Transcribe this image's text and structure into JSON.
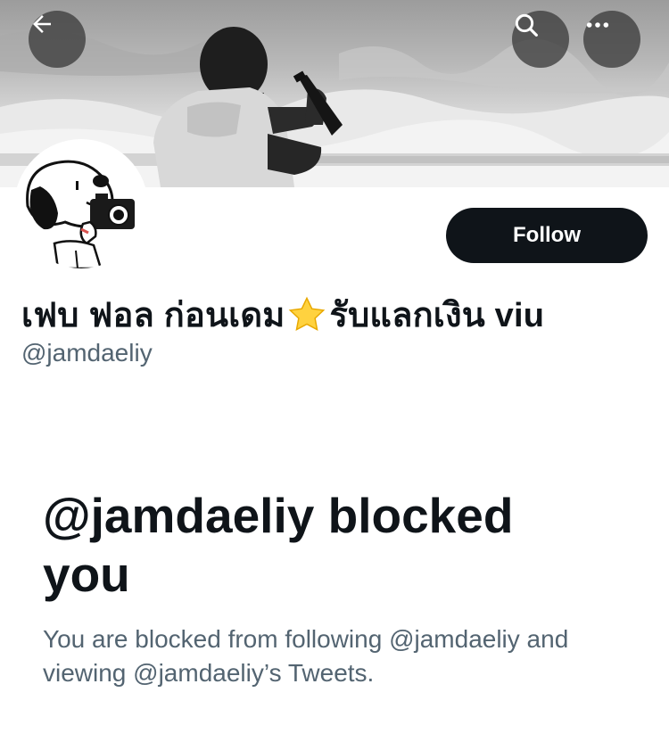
{
  "banner": {
    "back_icon": "arrow-left-icon",
    "search_icon": "search-icon",
    "more_icon": "more-horizontal-icon"
  },
  "profile": {
    "name_part1": "เฟบ ฟอล ก่อนเดม",
    "name_emoji": "star-emoji",
    "name_part2": "รับแลกเงิน viu",
    "handle": "@jamdaeliy",
    "follow_label": "Follow"
  },
  "blocked": {
    "title": "@jamdaeliy blocked you",
    "description": "You are blocked from following @jamdaeliy and viewing @jamdaeliy’s Tweets."
  },
  "colors": {
    "primary_text": "#0f1419",
    "secondary_text": "#536471",
    "button_bg": "#0f1419",
    "button_text": "#ffffff"
  }
}
